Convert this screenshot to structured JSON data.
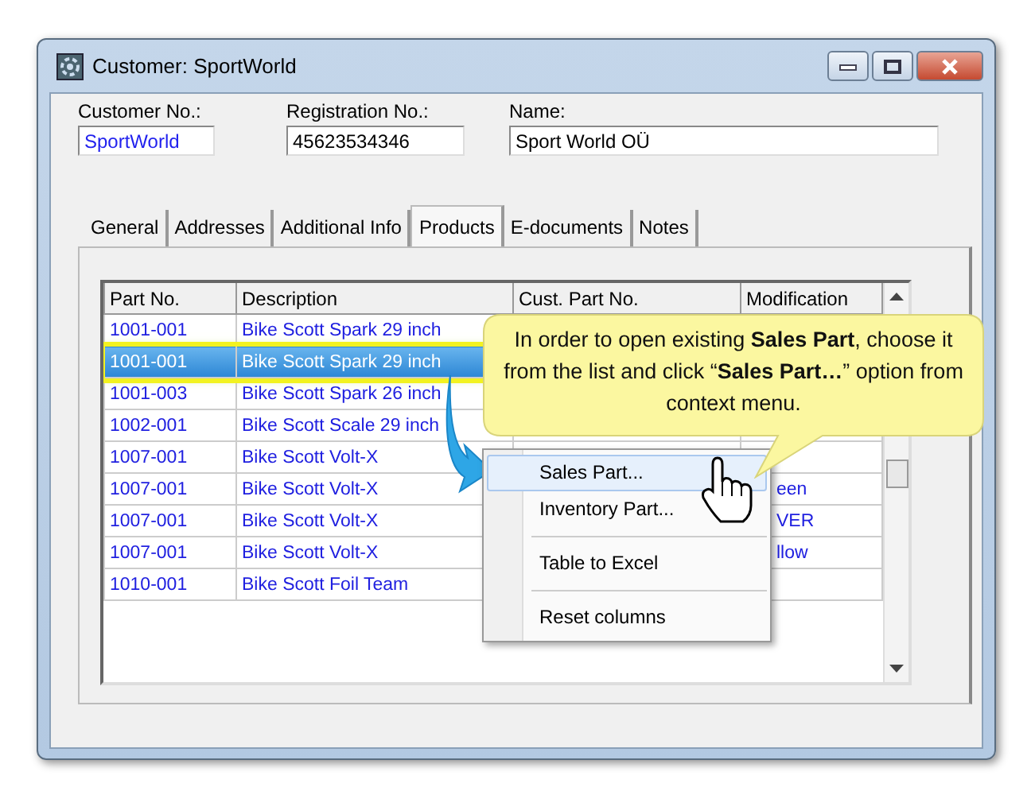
{
  "window": {
    "title": "Customer: SportWorld"
  },
  "fields": [
    {
      "label": "Customer No.:",
      "value": "SportWorld",
      "linked": true
    },
    {
      "label": "Registration No.:",
      "value": "45623534346",
      "linked": false
    },
    {
      "label": "Name:",
      "value": "Sport World OÜ",
      "linked": false
    }
  ],
  "tabs": [
    {
      "label": "General",
      "selected": false
    },
    {
      "label": "Addresses",
      "selected": false
    },
    {
      "label": "Additional Info",
      "selected": false
    },
    {
      "label": "Products",
      "selected": true
    },
    {
      "label": "E-documents",
      "selected": false
    },
    {
      "label": "Notes",
      "selected": false
    }
  ],
  "table": {
    "columns": [
      "Part No.",
      "Description",
      "Cust. Part No.",
      "Modification"
    ],
    "rows": [
      {
        "part_no": "1001-001",
        "description": "Bike Scott Spark 29 inch",
        "selected": false
      },
      {
        "part_no": "1001-001",
        "description": "Bike Scott Spark 29 inch",
        "selected": true
      },
      {
        "part_no": "1001-003",
        "description": "Bike Scott Spark 26 inch",
        "selected": false
      },
      {
        "part_no": "1002-001",
        "description": "Bike Scott Scale 29 inch",
        "selected": false
      },
      {
        "part_no": "1007-001",
        "description": "Bike Scott Volt-X",
        "selected": false
      },
      {
        "part_no": "1007-001",
        "description": "Bike Scott Volt-X",
        "modification": "een",
        "selected": false
      },
      {
        "part_no": "1007-001",
        "description": "Bike Scott Volt-X",
        "modification": "VER",
        "selected": false
      },
      {
        "part_no": "1007-001",
        "description": "Bike Scott Volt-X",
        "modification": "llow",
        "selected": false
      },
      {
        "part_no": "1010-001",
        "description": "Bike Scott Foil Team",
        "selected": false
      }
    ]
  },
  "context_menu": {
    "items": [
      {
        "kind": "item",
        "label": "Sales Part...",
        "selected": true
      },
      {
        "kind": "item",
        "label": "Inventory Part...",
        "selected": false
      },
      {
        "kind": "separator"
      },
      {
        "kind": "item",
        "label": "Table to Excel",
        "selected": false
      },
      {
        "kind": "separator"
      },
      {
        "kind": "item",
        "label": "Reset columns",
        "selected": false
      }
    ]
  },
  "callout": {
    "text": "In order to open existing **Sales Part**, choose it from the list and click “**Sales Part…**” option from context menu."
  }
}
